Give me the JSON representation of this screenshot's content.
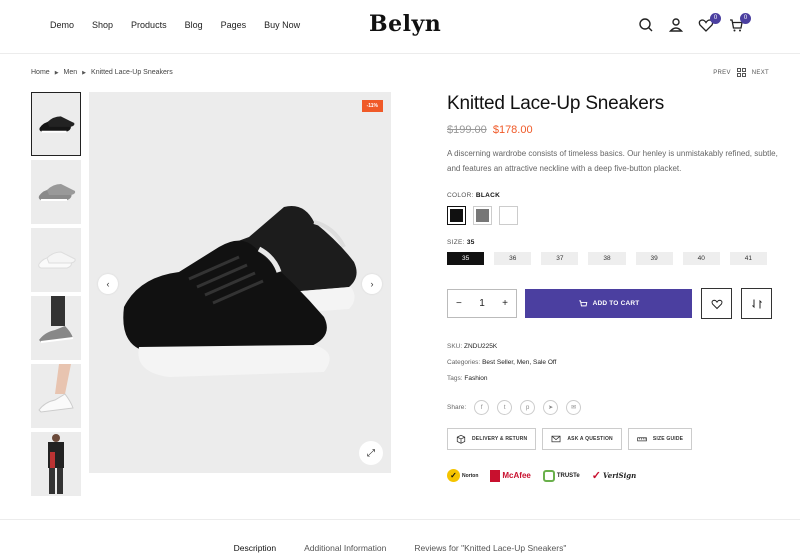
{
  "nav": [
    "Demo",
    "Shop",
    "Products",
    "Blog",
    "Pages",
    "Buy Now"
  ],
  "logo": "Belyn",
  "header": {
    "wishlist_count": "0",
    "cart_count": "0"
  },
  "breadcrumb": [
    "Home",
    "Men",
    "Knitted Lace-Up Sneakers"
  ],
  "pager": {
    "prev": "PREV",
    "next": "NEXT"
  },
  "product": {
    "sale_badge": "-11%",
    "title": "Knitted Lace-Up Sneakers",
    "old_price": "$199.00",
    "new_price": "$178.00",
    "description": "A discerning wardrobe consists of timeless basics. Our henley is unmistakably refined, subtle, and features an attractive neckline with a deep five-button placket.",
    "color_label": "COLOR:",
    "color_value": "BLACK",
    "colors": [
      "#111111",
      "#777777",
      "#ffffff"
    ],
    "size_label": "SIZE:",
    "size_value": "35",
    "sizes": [
      "35",
      "36",
      "37",
      "38",
      "39",
      "40",
      "41"
    ],
    "quantity": "1",
    "add_to_cart": "ADD TO CART",
    "sku_label": "SKU:",
    "sku": "ZNDU225K",
    "categories_label": "Categories:",
    "categories": "Best Seller, Men, Sale Off",
    "tags_label": "Tags:",
    "tags": "Fashion",
    "share_label": "Share:"
  },
  "actions": [
    "DELIVERY & RETURN",
    "ASK A QUESTION",
    "SIZE GUIDE"
  ],
  "trust": [
    "Norton",
    "McAfee",
    "TRUSTe",
    "VeriSign"
  ],
  "tabs": [
    "Description",
    "Additional Information",
    "Reviews for \"Knitted Lace-Up Sneakers\""
  ],
  "brand_color": "#4b3fa0",
  "sale_color": "#f05a28"
}
